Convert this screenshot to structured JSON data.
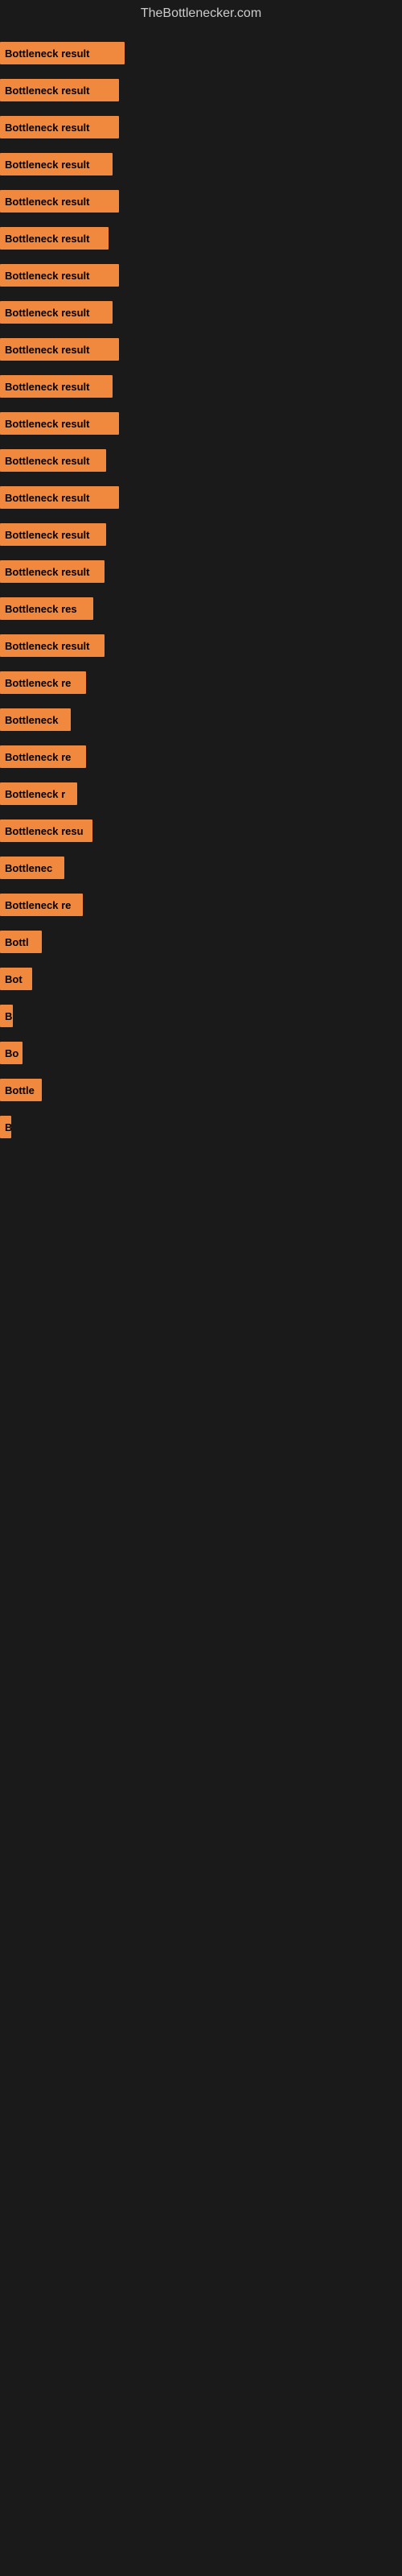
{
  "site": {
    "title": "TheBottlenecker.com"
  },
  "bars": [
    {
      "id": 1,
      "label": "Bottleneck result",
      "width": 155
    },
    {
      "id": 2,
      "label": "Bottleneck result",
      "width": 148
    },
    {
      "id": 3,
      "label": "Bottleneck result",
      "width": 148
    },
    {
      "id": 4,
      "label": "Bottleneck result",
      "width": 140
    },
    {
      "id": 5,
      "label": "Bottleneck result",
      "width": 148
    },
    {
      "id": 6,
      "label": "Bottleneck result",
      "width": 135
    },
    {
      "id": 7,
      "label": "Bottleneck result",
      "width": 148
    },
    {
      "id": 8,
      "label": "Bottleneck result",
      "width": 140
    },
    {
      "id": 9,
      "label": "Bottleneck result",
      "width": 148
    },
    {
      "id": 10,
      "label": "Bottleneck result",
      "width": 140
    },
    {
      "id": 11,
      "label": "Bottleneck result",
      "width": 148
    },
    {
      "id": 12,
      "label": "Bottleneck result",
      "width": 132
    },
    {
      "id": 13,
      "label": "Bottleneck result",
      "width": 148
    },
    {
      "id": 14,
      "label": "Bottleneck result",
      "width": 132
    },
    {
      "id": 15,
      "label": "Bottleneck result",
      "width": 130
    },
    {
      "id": 16,
      "label": "Bottleneck res",
      "width": 116
    },
    {
      "id": 17,
      "label": "Bottleneck result",
      "width": 130
    },
    {
      "id": 18,
      "label": "Bottleneck re",
      "width": 107
    },
    {
      "id": 19,
      "label": "Bottleneck",
      "width": 88
    },
    {
      "id": 20,
      "label": "Bottleneck re",
      "width": 107
    },
    {
      "id": 21,
      "label": "Bottleneck r",
      "width": 96
    },
    {
      "id": 22,
      "label": "Bottleneck resu",
      "width": 115
    },
    {
      "id": 23,
      "label": "Bottlenec",
      "width": 80
    },
    {
      "id": 24,
      "label": "Bottleneck re",
      "width": 103
    },
    {
      "id": 25,
      "label": "Bottl",
      "width": 52
    },
    {
      "id": 26,
      "label": "Bot",
      "width": 40
    },
    {
      "id": 27,
      "label": "B",
      "width": 16
    },
    {
      "id": 28,
      "label": "Bo",
      "width": 28
    },
    {
      "id": 29,
      "label": "Bottle",
      "width": 52
    },
    {
      "id": 30,
      "label": "B",
      "width": 14
    }
  ]
}
